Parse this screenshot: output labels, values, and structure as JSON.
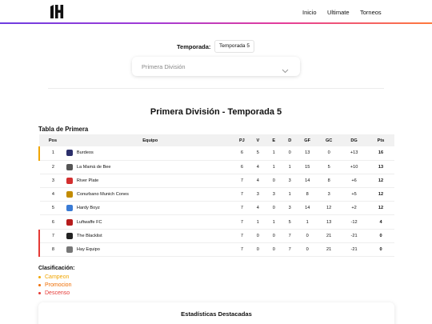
{
  "header": {
    "logo_text": "1H",
    "nav": [
      "Inicio",
      "Ultimate",
      "Torneos"
    ]
  },
  "filters": {
    "season_label": "Temporada:",
    "season_value": "Temporada 5",
    "division_value": "Primera División"
  },
  "page_title": "Primera División - Temporada 5",
  "table": {
    "title": "Tabla de Primera",
    "columns": [
      "Pos",
      "Equipo",
      "PJ",
      "V",
      "E",
      "D",
      "GF",
      "GC",
      "DG",
      "Pts"
    ],
    "rows": [
      {
        "pos": "1",
        "team": "Burdeos",
        "pj": "6",
        "v": "5",
        "e": "1",
        "d": "0",
        "gf": "13",
        "gc": "0",
        "dg": "+13",
        "pts": "16",
        "crest": "#2b2f6b",
        "zone": "camp"
      },
      {
        "pos": "2",
        "team": "La Mamá de Bee",
        "pj": "6",
        "v": "4",
        "e": "1",
        "d": "1",
        "gf": "15",
        "gc": "5",
        "dg": "+10",
        "pts": "13",
        "crest": "#555555",
        "zone": ""
      },
      {
        "pos": "3",
        "team": "River Plate",
        "pj": "7",
        "v": "4",
        "e": "0",
        "d": "3",
        "gf": "14",
        "gc": "8",
        "dg": "+6",
        "pts": "12",
        "crest": "#d32f2f",
        "zone": ""
      },
      {
        "pos": "4",
        "team": "Conurbano Munich Cones",
        "pj": "7",
        "v": "3",
        "e": "3",
        "d": "1",
        "gf": "8",
        "gc": "3",
        "dg": "+5",
        "pts": "12",
        "crest": "#c28b00",
        "zone": ""
      },
      {
        "pos": "5",
        "team": "Hardy Boyz",
        "pj": "7",
        "v": "4",
        "e": "0",
        "d": "3",
        "gf": "14",
        "gc": "12",
        "dg": "+2",
        "pts": "12",
        "crest": "#3a7bd5",
        "zone": ""
      },
      {
        "pos": "6",
        "team": "Luftwaffe FC",
        "pj": "7",
        "v": "1",
        "e": "1",
        "d": "5",
        "gf": "1",
        "gc": "13",
        "dg": "-12",
        "pts": "4",
        "crest": "#b71c1c",
        "zone": ""
      },
      {
        "pos": "7",
        "team": "The Blacklist",
        "pj": "7",
        "v": "0",
        "e": "0",
        "d": "7",
        "gf": "0",
        "gc": "21",
        "dg": "-21",
        "pts": "0",
        "crest": "#222222",
        "zone": "desc"
      },
      {
        "pos": "8",
        "team": "Hay Equipo",
        "pj": "7",
        "v": "0",
        "e": "0",
        "d": "7",
        "gf": "0",
        "gc": "21",
        "dg": "-21",
        "pts": "0",
        "crest": "#777777",
        "zone": "desc"
      }
    ]
  },
  "legend": {
    "title": "Clasificación:",
    "items": [
      "Campeon",
      "Promocion",
      "Descenso"
    ],
    "colors": [
      "#f0a500",
      "#ef6c00",
      "#e53935"
    ]
  },
  "stats": {
    "title": "Estadísticas Destacadas"
  }
}
